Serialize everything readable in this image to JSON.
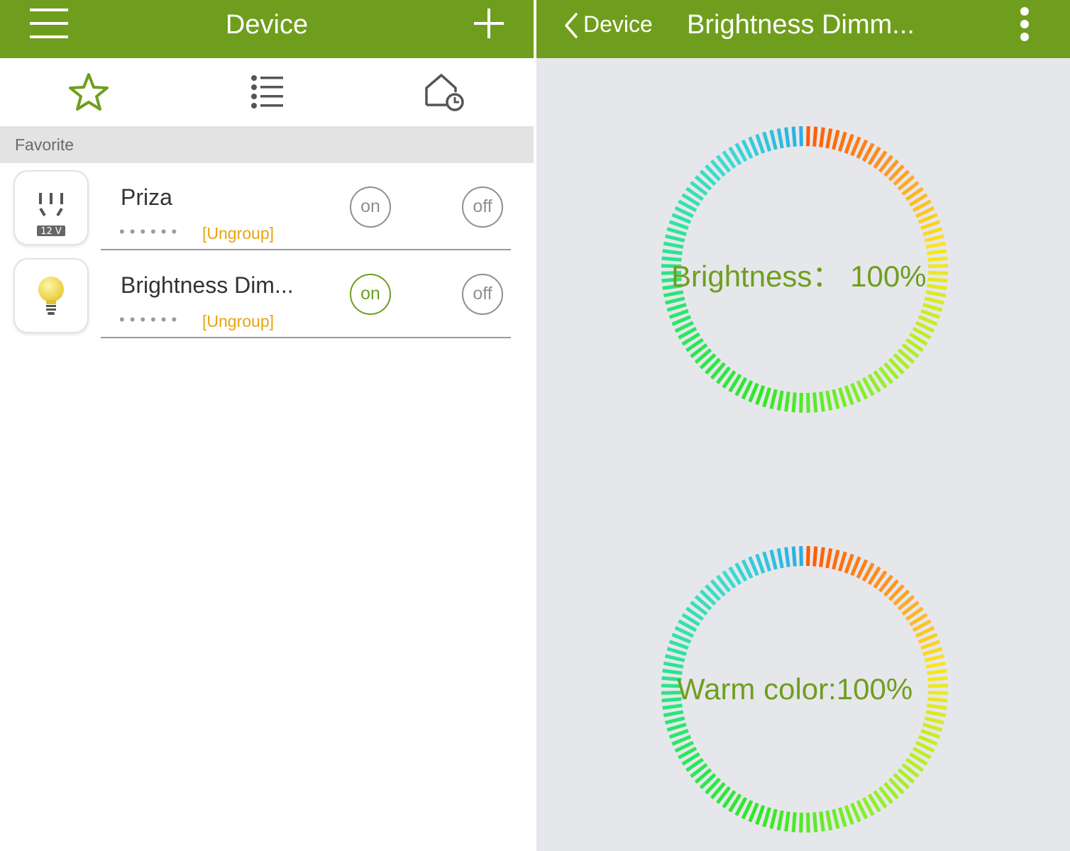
{
  "left": {
    "title": "Device",
    "section_title": "Favorite",
    "devices": [
      {
        "name": "Priza",
        "dots": "••••••",
        "group": "[Ungroup]",
        "on_label": "on",
        "off_label": "off",
        "icon": "power-socket-icon",
        "icon_badge": "12 V",
        "on_active": false
      },
      {
        "name": "Brightness Dim...",
        "dots": "••••••",
        "group": "[Ungroup]",
        "on_label": "on",
        "off_label": "off",
        "icon": "light-bulb-icon",
        "on_active": true
      }
    ],
    "tabs": [
      {
        "icon": "star-icon",
        "active": true
      },
      {
        "icon": "list-icon",
        "active": false
      },
      {
        "icon": "home-schedule-icon",
        "active": false
      }
    ]
  },
  "right": {
    "back_label": "Device",
    "title": "Brightness Dimm...",
    "brightness_label": "Brightness：  100%",
    "brightness_value": 100,
    "warm_label": "Warm color:100%",
    "warm_value": 100
  },
  "colors": {
    "header_green": "#6f9e1e",
    "accent_orange": "#e8a410",
    "panel_gray": "#e6e7eb"
  }
}
